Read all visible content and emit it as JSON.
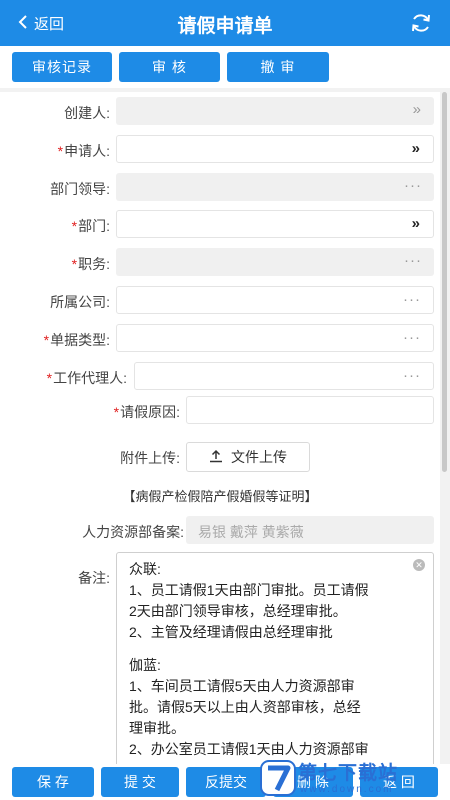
{
  "header": {
    "back_label": "返回",
    "title": "请假申请单"
  },
  "toolbar": {
    "audit_record": "审核记录",
    "audit": "审 核",
    "revoke": "撤 审"
  },
  "form": {
    "creator_label": "创建人:",
    "applicant_label": "申请人:",
    "dept_leader_label": "部门领导:",
    "dept_label": "部门:",
    "position_label": "职务:",
    "company_label": "所属公司:",
    "doc_type_label": "单据类型:",
    "agent_label": "工作代理人:",
    "reason_label": "请假原因:",
    "attach_label": "附件上传:",
    "upload_button": "文件上传",
    "hint": "【病假产检假陪产假婚假等证明】",
    "hr_label": "人力资源部备案:",
    "hr_value": "易银 戴萍 黄紫薇",
    "notes_label": "备注:",
    "required_mark": "*",
    "more_glyph": "···",
    "select_glyph": "»"
  },
  "notes": {
    "lines": [
      "众联:",
      "1、员工请假1天由部门审批。员工请假",
      "2天由部门领导审核，总经理审批。",
      "2、主管及经理请假由总经理审批",
      "",
      "伽蓝:",
      "1、车间员工请假5天由人力资源部审",
      "批。请假5天以上由人资部审核，总经",
      "理审批。",
      "2、办公室员工请假1天由人力资源部审"
    ]
  },
  "bottombar": {
    "save": "保 存",
    "submit": "提 交",
    "reverse_submit": "反提交",
    "delete": "删 除",
    "back": "返 回"
  },
  "watermark": {
    "title": "第七下载站",
    "url": "www.down.com"
  },
  "colors": {
    "primary": "#1e8be6",
    "required": "#e02020"
  }
}
